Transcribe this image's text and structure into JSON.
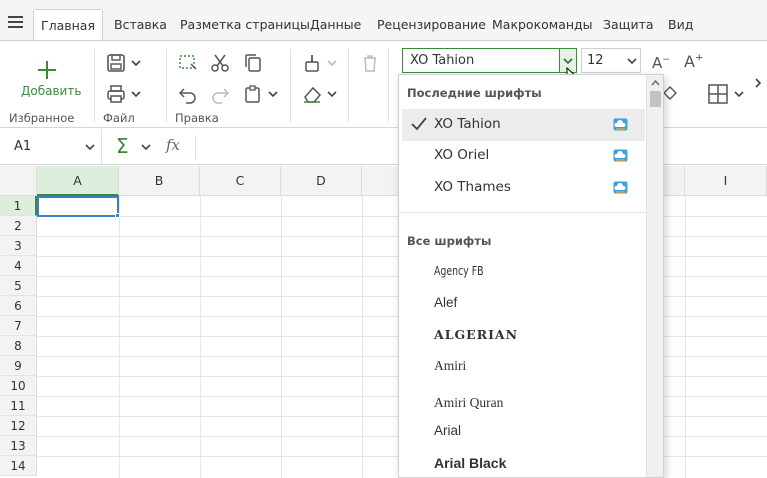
{
  "tabs": {
    "items": [
      {
        "label": "Главная"
      },
      {
        "label": "Вставка"
      },
      {
        "label": "Разметка страницы"
      },
      {
        "label": "Данные"
      },
      {
        "label": "Рецензирование"
      },
      {
        "label": "Макрокоманды"
      },
      {
        "label": "Защита"
      },
      {
        "label": "Вид"
      }
    ],
    "active": "Главная"
  },
  "ribbon": {
    "add_label": "Добавить",
    "groups": {
      "favorites": "Избранное",
      "file": "Файл",
      "edit": "Правка"
    },
    "font": {
      "current": "XO Tahion",
      "size": "12"
    }
  },
  "formula_bar": {
    "cell_ref": "A1",
    "sum_icon": "sigma-icon",
    "fx_icon": "fx-icon"
  },
  "grid": {
    "columns": [
      "A",
      "B",
      "C",
      "D",
      "I"
    ],
    "rows": [
      "1",
      "2",
      "3",
      "4",
      "5",
      "6",
      "7",
      "8",
      "9",
      "10",
      "11",
      "12",
      "13",
      "14"
    ],
    "selected_cell": "A1"
  },
  "font_dropdown": {
    "recent_header": "Последние шрифты",
    "recent": [
      "XO Tahion",
      "XO Oriel",
      "XO Thames"
    ],
    "all_header": "Все шрифты",
    "all": [
      "Agency FB",
      "Alef",
      "ALGERIAN",
      "Amiri",
      "Amiri Quran",
      "Arial",
      "Arial Black"
    ]
  },
  "colors": {
    "accent": "#3a8a3a",
    "selection": "#3a7fcf",
    "tab_bg": "#f5f5f5"
  }
}
